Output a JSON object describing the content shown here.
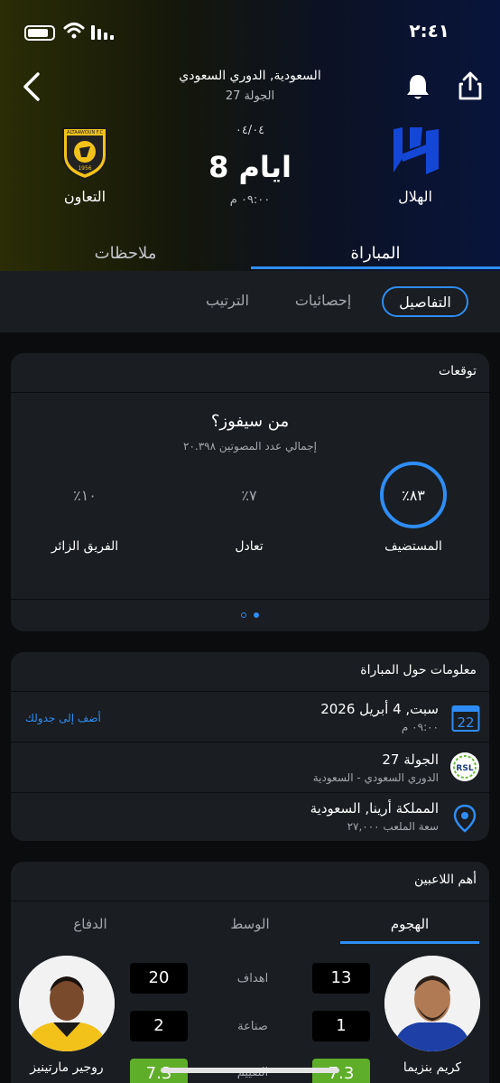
{
  "status_bar": {
    "time": "٢:٤١"
  },
  "header": {
    "league": "السعودية, الدوري السعودي",
    "round": "الجولة 27",
    "date_short": "٠٤/٠٤",
    "countdown": "8 ايام",
    "kickoff": "٠٩:٠٠ م",
    "home_team": "الهلال",
    "away_team": "التعاون",
    "away_logo_text": "ALTAAWOUN F.C",
    "away_logo_year": "1956",
    "colors": {
      "accent": "#2e8df5",
      "home_brand": "#1447d6",
      "away_brand": "#f2c21a"
    }
  },
  "tabs": {
    "match": "المباراة",
    "notes": "ملاحظات"
  },
  "subtabs": {
    "details": "التفاصيل",
    "stats": "إحصائيات",
    "standings": "الترتيب"
  },
  "predictions": {
    "title": "توقعات",
    "question": "من سيفوز؟",
    "total_votes": "إجمالي عدد المصوتين ٢٠.٣٩٨",
    "home_pct": "٪٨٣",
    "home_label": "المستضيف",
    "draw_pct": "٪٧",
    "draw_label": "تعادل",
    "away_pct": "٪١٠",
    "away_label": "الفريق الزائر"
  },
  "match_info": {
    "title": "معلومات حول المباراة",
    "date": "سبت, 4 أبريل 2026",
    "time": "٠٩:٠٠ م",
    "calendar_day": "22",
    "add_calendar": "أضف إلى جدولك",
    "round": "الجولة 27",
    "competition": "الدوري السعودي - السعودية",
    "league_logo_text": "RSL",
    "venue": "المملكة أرينا, السعودية",
    "capacity": "سعة الملعب ٢٧,٠٠٠"
  },
  "top_players": {
    "title": "أهم اللاعبين",
    "tabs": {
      "attack": "الهجوم",
      "midfield": "الوسط",
      "defense": "الدفاع"
    },
    "stat_labels": {
      "goals": "اهداف",
      "assists": "صناعة",
      "rating": "التقييم"
    },
    "home_player": {
      "name": "كريم بنزيما",
      "goals": "13",
      "assists": "1",
      "rating": "7.3"
    },
    "away_player": {
      "name": "روجير مارتينيز",
      "goals": "20",
      "assists": "2",
      "rating": "7.3"
    }
  }
}
